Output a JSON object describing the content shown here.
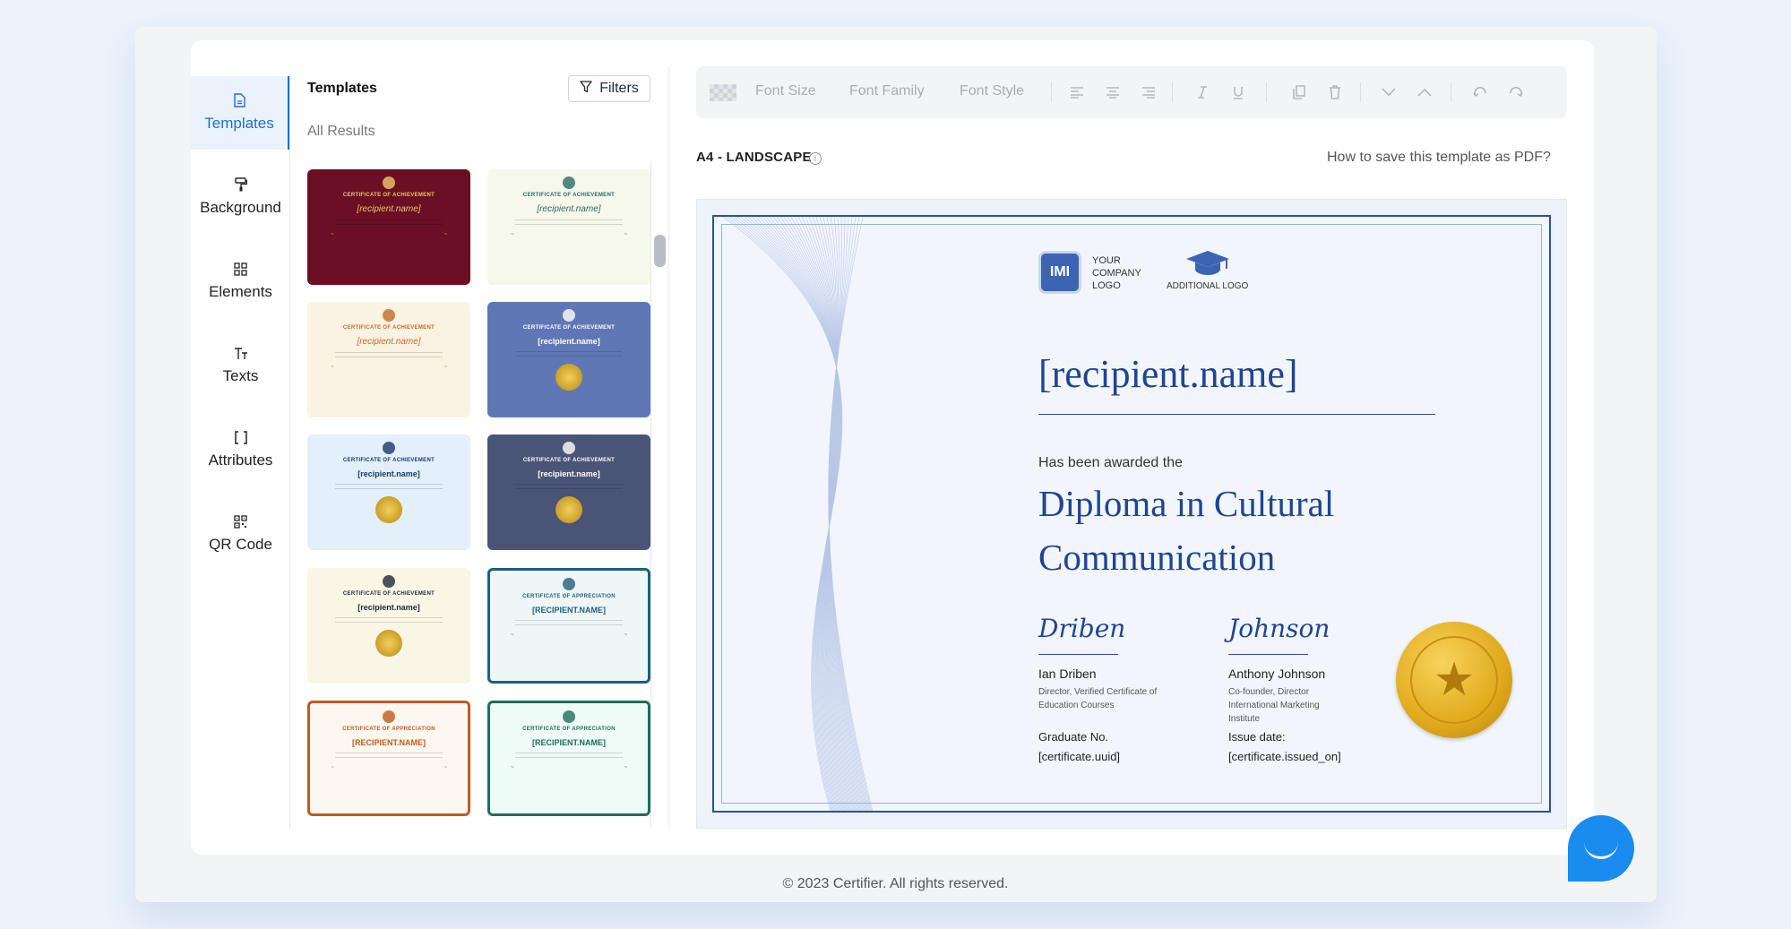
{
  "rail": [
    {
      "label": "Templates",
      "icon": "file-icon"
    },
    {
      "label": "Background",
      "icon": "paint-roller-icon"
    },
    {
      "label": "Elements",
      "icon": "grid-icon"
    },
    {
      "label": "Texts",
      "icon": "text-icon"
    },
    {
      "label": "Attributes",
      "icon": "brackets-icon"
    },
    {
      "label": "QR Code",
      "icon": "qr-code-icon"
    }
  ],
  "panel": {
    "title": "Templates",
    "filters": "Filters",
    "subtitle": "All Results"
  },
  "thumbs": [
    {
      "cap": "CERTIFICATE OF ACHIEVEMENT",
      "name": "[recipient.name]",
      "bg": "#6a0f24",
      "fg": "#f2c56b"
    },
    {
      "cap": "CERTIFICATE OF ACHIEVEMENT",
      "name": "[recipient.name]",
      "bg": "#f5f8ea",
      "fg": "#2a6b5f"
    },
    {
      "cap": "CERTIFICATE OF ACHIEVEMENT",
      "name": "[recipient.name]",
      "bg": "#faf3e3",
      "fg": "#c16a2a"
    },
    {
      "cap": "CERTIFICATE OF ACHIEVEMENT",
      "name": "[recipient.name]",
      "bg": "#5f78b5",
      "fg": "#ffffff"
    },
    {
      "cap": "CERTIFICATE OF ACHIEVEMENT",
      "name": "[recipient.name]",
      "bg": "#e3effa",
      "fg": "#1f3766"
    },
    {
      "cap": "CERTIFICATE OF ACHIEVEMENT",
      "name": "[recipient.name]",
      "bg": "#4a5476",
      "fg": "#ffffff"
    },
    {
      "cap": "CERTIFICATE OF ACHIEVEMENT",
      "name": "[recipient.name]",
      "bg": "#f9f6e6",
      "fg": "#1f2937"
    },
    {
      "cap": "CERTIFICATE OF APPRECIATION",
      "name": "[RECIPIENT.NAME]",
      "bg": "#eef7f8",
      "fg": "#1f5f79"
    },
    {
      "cap": "CERTIFICATE OF APPRECIATION",
      "name": "[RECIPIENT.NAME]",
      "bg": "#fdf8ef",
      "fg": "#c15a1f"
    },
    {
      "cap": "CERTIFICATE OF APPRECIATION",
      "name": "[RECIPIENT.NAME]",
      "bg": "#eefbf7",
      "fg": "#1f6e5a"
    }
  ],
  "toolbar": {
    "font_size": "Font Size",
    "font_family": "Font Family",
    "font_style": "Font Style"
  },
  "canvas": {
    "size_label": "A4 - LANDSCAPE",
    "info_icon": "i",
    "howto": "How to save this template as PDF?"
  },
  "certificate": {
    "logo_text": "IMI",
    "company_logo": "YOUR COMPANY LOGO",
    "additional_logo": "ADDITIONAL LOGO",
    "recipient": "[recipient.name]",
    "awarded": "Has been awarded the",
    "title": "Diploma in Cultural Communication",
    "sig1": "Driben",
    "sig2": "Johnson",
    "person1": "Ian Driben",
    "role1": "Director, Verified Certificate of Education Courses",
    "person2": "Anthony Johnson",
    "role2": "Co-founder, Director International Marketing Institute",
    "graduate_label": "Graduate No.",
    "graduate_value": "[certificate.uuid]",
    "issue_label": "Issue date:",
    "issue_value": "[certificate.issued_on]"
  },
  "footer": "© 2023 Certifier. All rights reserved."
}
